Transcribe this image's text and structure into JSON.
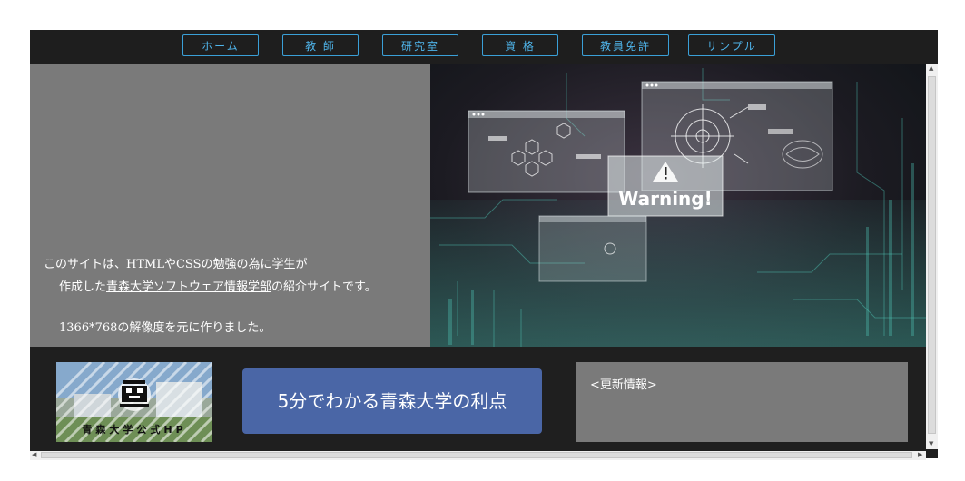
{
  "nav": {
    "items": [
      {
        "label": "ホーム"
      },
      {
        "label": "教 師"
      },
      {
        "label": "研究室"
      },
      {
        "label": "資 格"
      },
      {
        "label": "教員免許"
      },
      {
        "label": "サンプル"
      }
    ]
  },
  "hero": {
    "line1": "このサイトは、HTMLやCSSの勉強の為に学生が",
    "line2_prefix": "作成した",
    "line2_link": "青森大学ソフトウェア情報学部",
    "line2_suffix": "の紹介サイトです。",
    "line3": "1366*768の解像度を元に作りました。",
    "image_caption": "Warning!"
  },
  "bottom": {
    "logo_text": "青森大学公式HP",
    "cta_label": "5分でわかる青森大学の利点",
    "news_title": "<更新情報>"
  },
  "colors": {
    "nav_background": "#1e1e1e",
    "nav_border": "#3aa0d8",
    "nav_text": "#4fb4ea",
    "panel_gray": "#7a7a7a",
    "cta_blue": "#4a66a6",
    "page_dark": "#1f1f1f"
  },
  "icons": [
    "warning-icon",
    "scroll-up-arrow-icon",
    "scroll-down-arrow-icon",
    "scroll-left-arrow-icon",
    "scroll-right-arrow-icon"
  ]
}
